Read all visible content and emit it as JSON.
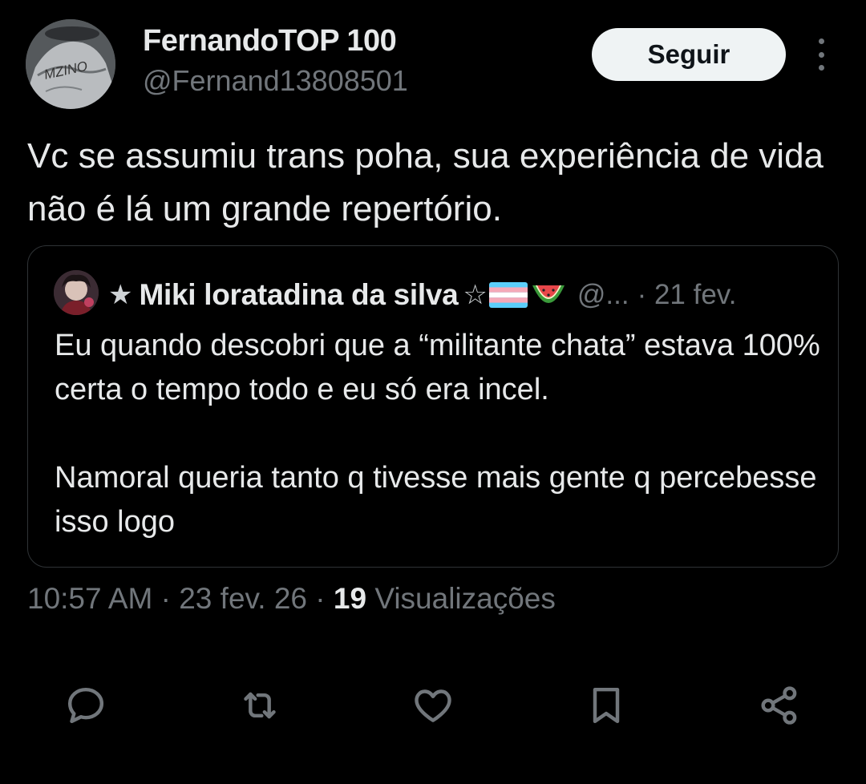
{
  "author": {
    "name": "FernandoTOP 100",
    "handle": "@Fernand13808501",
    "avatar_text": "MZINO"
  },
  "follow_label": "Seguir",
  "tweet_text": "Vc se assumiu trans poha, sua experiência de vida não é lá um grande repertório.",
  "quote": {
    "name": "Miki loratadina da silva",
    "handle": "@...",
    "date": "· 21 fev.",
    "paragraph1": "Eu quando descobri que a “militante chata” estava 100% certa o tempo todo e eu só era incel.",
    "paragraph2": "Namoral queria tanto q tivesse mais gente q percebesse isso logo"
  },
  "meta": {
    "time": "10:57 AM",
    "date": "23 fev. 26",
    "views_count": "19",
    "views_label": "Visualizações"
  },
  "icons": [
    "reply-icon",
    "retweet-icon",
    "like-icon",
    "bookmark-icon",
    "share-icon"
  ],
  "colors": {
    "background": "#000000",
    "text": "#e7e9ea",
    "secondary": "#71767b",
    "border": "#2f3336",
    "button_bg": "#eff3f4"
  }
}
